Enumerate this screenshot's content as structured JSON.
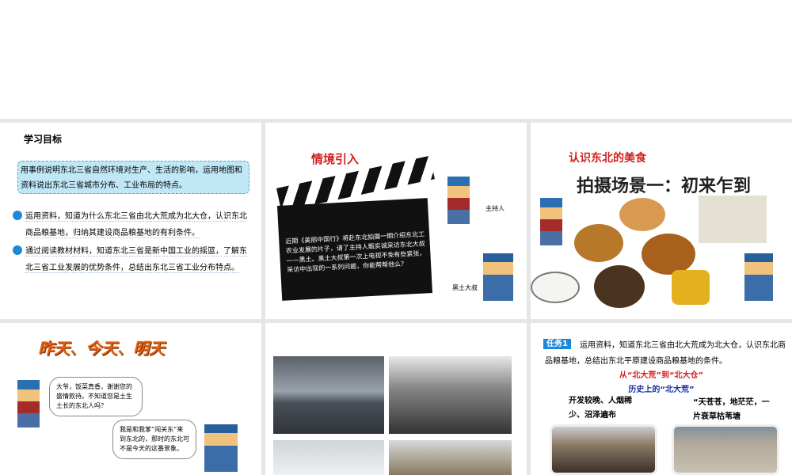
{
  "slide1": {
    "title": "学习目标",
    "goal": "用事例说明东北三省自然环境对生产、生活的影响，运用地图和资料说出东北三省城市分布、工业布局的特点。",
    "items": [
      "运用资料，知道为什么东北三省由北大荒成为北大仓，认识东北商品粮基地，归纳其建设商品粮基地的有利条件。",
      "通过阅读教材材料，知道东北三省是新中国工业的摇篮，了解东北三省工业发展的优势条件，总结出东北三省工业分布特点。"
    ]
  },
  "slide2": {
    "title": "情境引入",
    "clap_text": "近期《美丽中国行》将赴东北拍摄一期介绍东北工农业发展的片子，请了主持人甄实诚采访东北大叔——黑土。黑土大叔第一次上电视不免有些紧张，采访中出现的一系列问题，你能帮帮他么？",
    "host_label": "主持人",
    "uncle_label": "黑土大叔"
  },
  "slide3": {
    "title": "认识东北的美食",
    "subtitle": "拍摄场景一：初来乍到"
  },
  "slide4": {
    "title": "昨天、今天、明天",
    "bubble1": "大爷，饭菜真香，谢谢您的盛情款待。不知道您是土生土长的东北人吗？",
    "bubble2": "我是和我爹“闯关东”来到东北的，那时的东北可不是今天的这番景象。"
  },
  "slide6": {
    "badge": "任务1",
    "task": "运用资料，知道东北三省由北大荒成为北大仓，认识东北商品粮基地，总结出东北平原建设商品粮基地的条件。",
    "heading": "从“北大荒”到“北大仓”",
    "subheading": "历史上的“北大荒”",
    "left_text": "开发较晚、人烟稀少、沼泽遍布",
    "right_text": "“天苍苍，地茫茫，一片衰草枯苇塘"
  }
}
